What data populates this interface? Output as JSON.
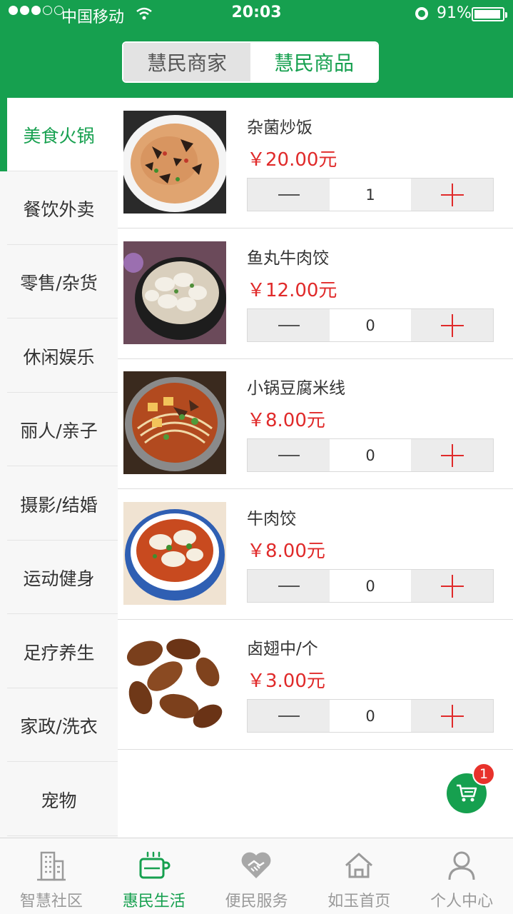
{
  "status_bar": {
    "carrier": "中国移动",
    "time": "20:03",
    "battery": "91%",
    "battery_level": 0.91,
    "signal_bars": 3,
    "signal_total": 5
  },
  "segment": {
    "options": [
      {
        "label": "慧民商家",
        "selected": false
      },
      {
        "label": "慧民商品",
        "selected": true
      }
    ]
  },
  "categories": [
    {
      "label": "美食火锅",
      "active": true
    },
    {
      "label": "餐饮外卖",
      "active": false
    },
    {
      "label": "零售/杂货",
      "active": false
    },
    {
      "label": "休闲娱乐",
      "active": false
    },
    {
      "label": "丽人/亲子",
      "active": false
    },
    {
      "label": "摄影/结婚",
      "active": false
    },
    {
      "label": "运动健身",
      "active": false
    },
    {
      "label": "足疗养生",
      "active": false
    },
    {
      "label": "家政/洗衣",
      "active": false
    },
    {
      "label": "宠物",
      "active": false
    }
  ],
  "products": [
    {
      "name": "杂菌炒饭",
      "price": "￥20.00元",
      "qty": "1"
    },
    {
      "name": "鱼丸牛肉饺",
      "price": "￥12.00元",
      "qty": "0"
    },
    {
      "name": "小锅豆腐米线",
      "price": "￥8.00元",
      "qty": "0"
    },
    {
      "name": "牛肉饺",
      "price": "￥8.00元",
      "qty": "0"
    },
    {
      "name": "卤翅中/个",
      "price": "￥3.00元",
      "qty": "0"
    }
  ],
  "cart": {
    "badge": "1",
    "icon": "cart-icon"
  },
  "tabs": [
    {
      "label": "智慧社区",
      "icon": "building-icon",
      "active": false
    },
    {
      "label": "惠民生活",
      "icon": "coffee-cup-icon",
      "active": true
    },
    {
      "label": "便民服务",
      "icon": "handshake-heart-icon",
      "active": false
    },
    {
      "label": "如玉首页",
      "icon": "home-icon",
      "active": false
    },
    {
      "label": "个人中心",
      "icon": "person-icon",
      "active": false
    }
  ],
  "colors": {
    "brand": "#16a04f",
    "price": "#e02a2a",
    "badge": "#e8322b",
    "inactive_tab": "#9a9a9a"
  }
}
